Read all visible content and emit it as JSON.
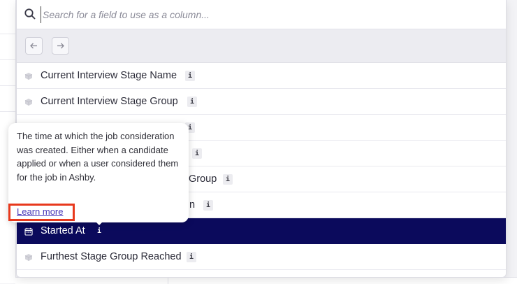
{
  "search": {
    "placeholder": "Search for a field to use as a column..."
  },
  "nav": {
    "back_icon": "arrow-left-icon",
    "forward_icon": "arrow-right-icon"
  },
  "fields": [
    {
      "label": "Current Interview Stage Name",
      "icon": "cube-icon",
      "info": "i"
    },
    {
      "label": "Current Interview Stage Group",
      "icon": "cube-icon",
      "info": "i"
    },
    {
      "label": "",
      "icon": "cube-icon",
      "info": "i"
    },
    {
      "label": "",
      "icon": "cube-icon",
      "info": "i"
    },
    {
      "label": "Group",
      "icon": "cube-icon",
      "info": "i"
    },
    {
      "label": "n",
      "icon": "cube-icon",
      "info": "i"
    },
    {
      "label": "Started At",
      "icon": "calendar-icon",
      "info": "i",
      "selected": true
    },
    {
      "label": "Furthest Stage Group Reached",
      "icon": "cube-icon",
      "info": "i"
    }
  ],
  "tooltip": {
    "text": "The time at which the job consideration was created. Either when a candidate applied or when a user considered them for the job in Ashby.",
    "link": "Learn more"
  },
  "colors": {
    "selected_bg": "#0b0a5c",
    "highlight_border": "#e8391d",
    "link": "#4535b8"
  }
}
